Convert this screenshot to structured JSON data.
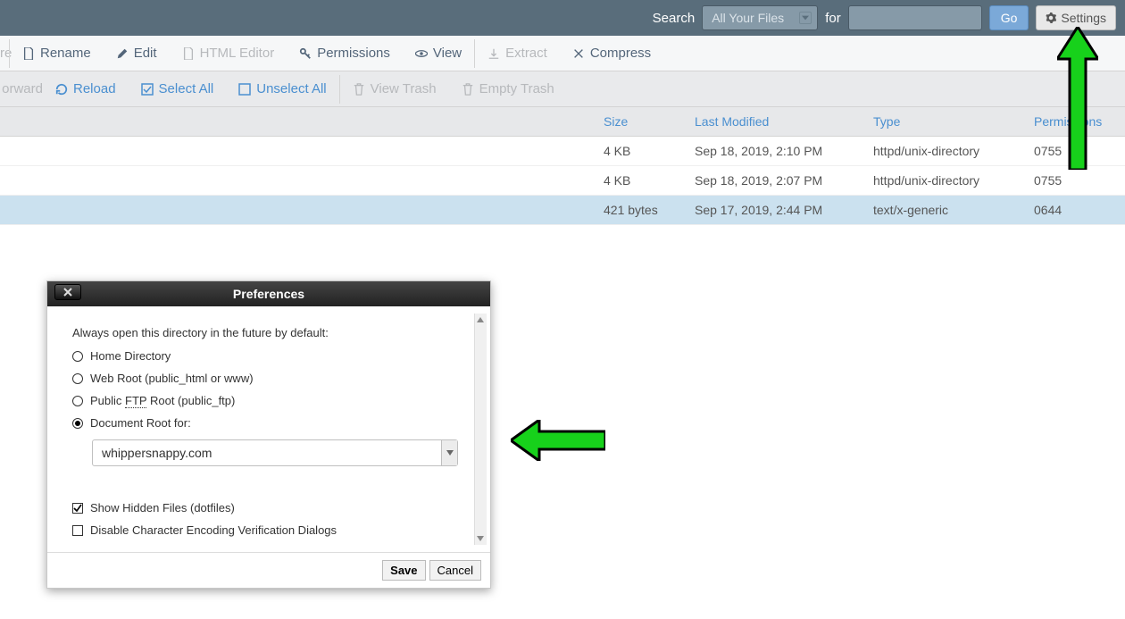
{
  "topbar": {
    "search_label": "Search",
    "scope_selected": "All Your Files",
    "for_label": "for",
    "search_value": "",
    "go_label": "Go",
    "settings_label": "Settings"
  },
  "toolbar1": {
    "more_cut": "re",
    "rename": "Rename",
    "edit": "Edit",
    "html_editor": "HTML Editor",
    "permissions": "Permissions",
    "view": "View",
    "extract": "Extract",
    "compress": "Compress"
  },
  "toolbar2": {
    "forward_cut": "orward",
    "reload": "Reload",
    "select_all": "Select All",
    "unselect_all": "Unselect All",
    "view_trash": "View Trash",
    "empty_trash": "Empty Trash"
  },
  "table": {
    "headers": {
      "size": "Size",
      "modified": "Last Modified",
      "type": "Type",
      "perms": "Permissions"
    },
    "rows": [
      {
        "size": "4 KB",
        "modified": "Sep 18, 2019, 2:10 PM",
        "type": "httpd/unix-directory",
        "perms": "0755",
        "selected": false
      },
      {
        "size": "4 KB",
        "modified": "Sep 18, 2019, 2:07 PM",
        "type": "httpd/unix-directory",
        "perms": "0755",
        "selected": false
      },
      {
        "size": "421 bytes",
        "modified": "Sep 17, 2019, 2:44 PM",
        "type": "text/x-generic",
        "perms": "0644",
        "selected": true
      }
    ]
  },
  "modal": {
    "title": "Preferences",
    "intro": "Always open this directory in the future by default:",
    "radios": {
      "home": {
        "label": "Home Directory",
        "checked": false
      },
      "webroot": {
        "label_pre": "Web Root (public_html or www)",
        "checked": false
      },
      "ftp": {
        "pre": "Public ",
        "ftp": "FTP",
        "post": " Root (public_ftp)",
        "checked": false
      },
      "docroot": {
        "label": "Document Root for:",
        "checked": true
      }
    },
    "domain_selected": "whippersnappy.com",
    "checks": {
      "hidden": {
        "label": "Show Hidden Files (dotfiles)",
        "checked": true
      },
      "encoding": {
        "label": "Disable Character Encoding Verification Dialogs",
        "checked": false
      }
    },
    "save": "Save",
    "cancel": "Cancel"
  }
}
